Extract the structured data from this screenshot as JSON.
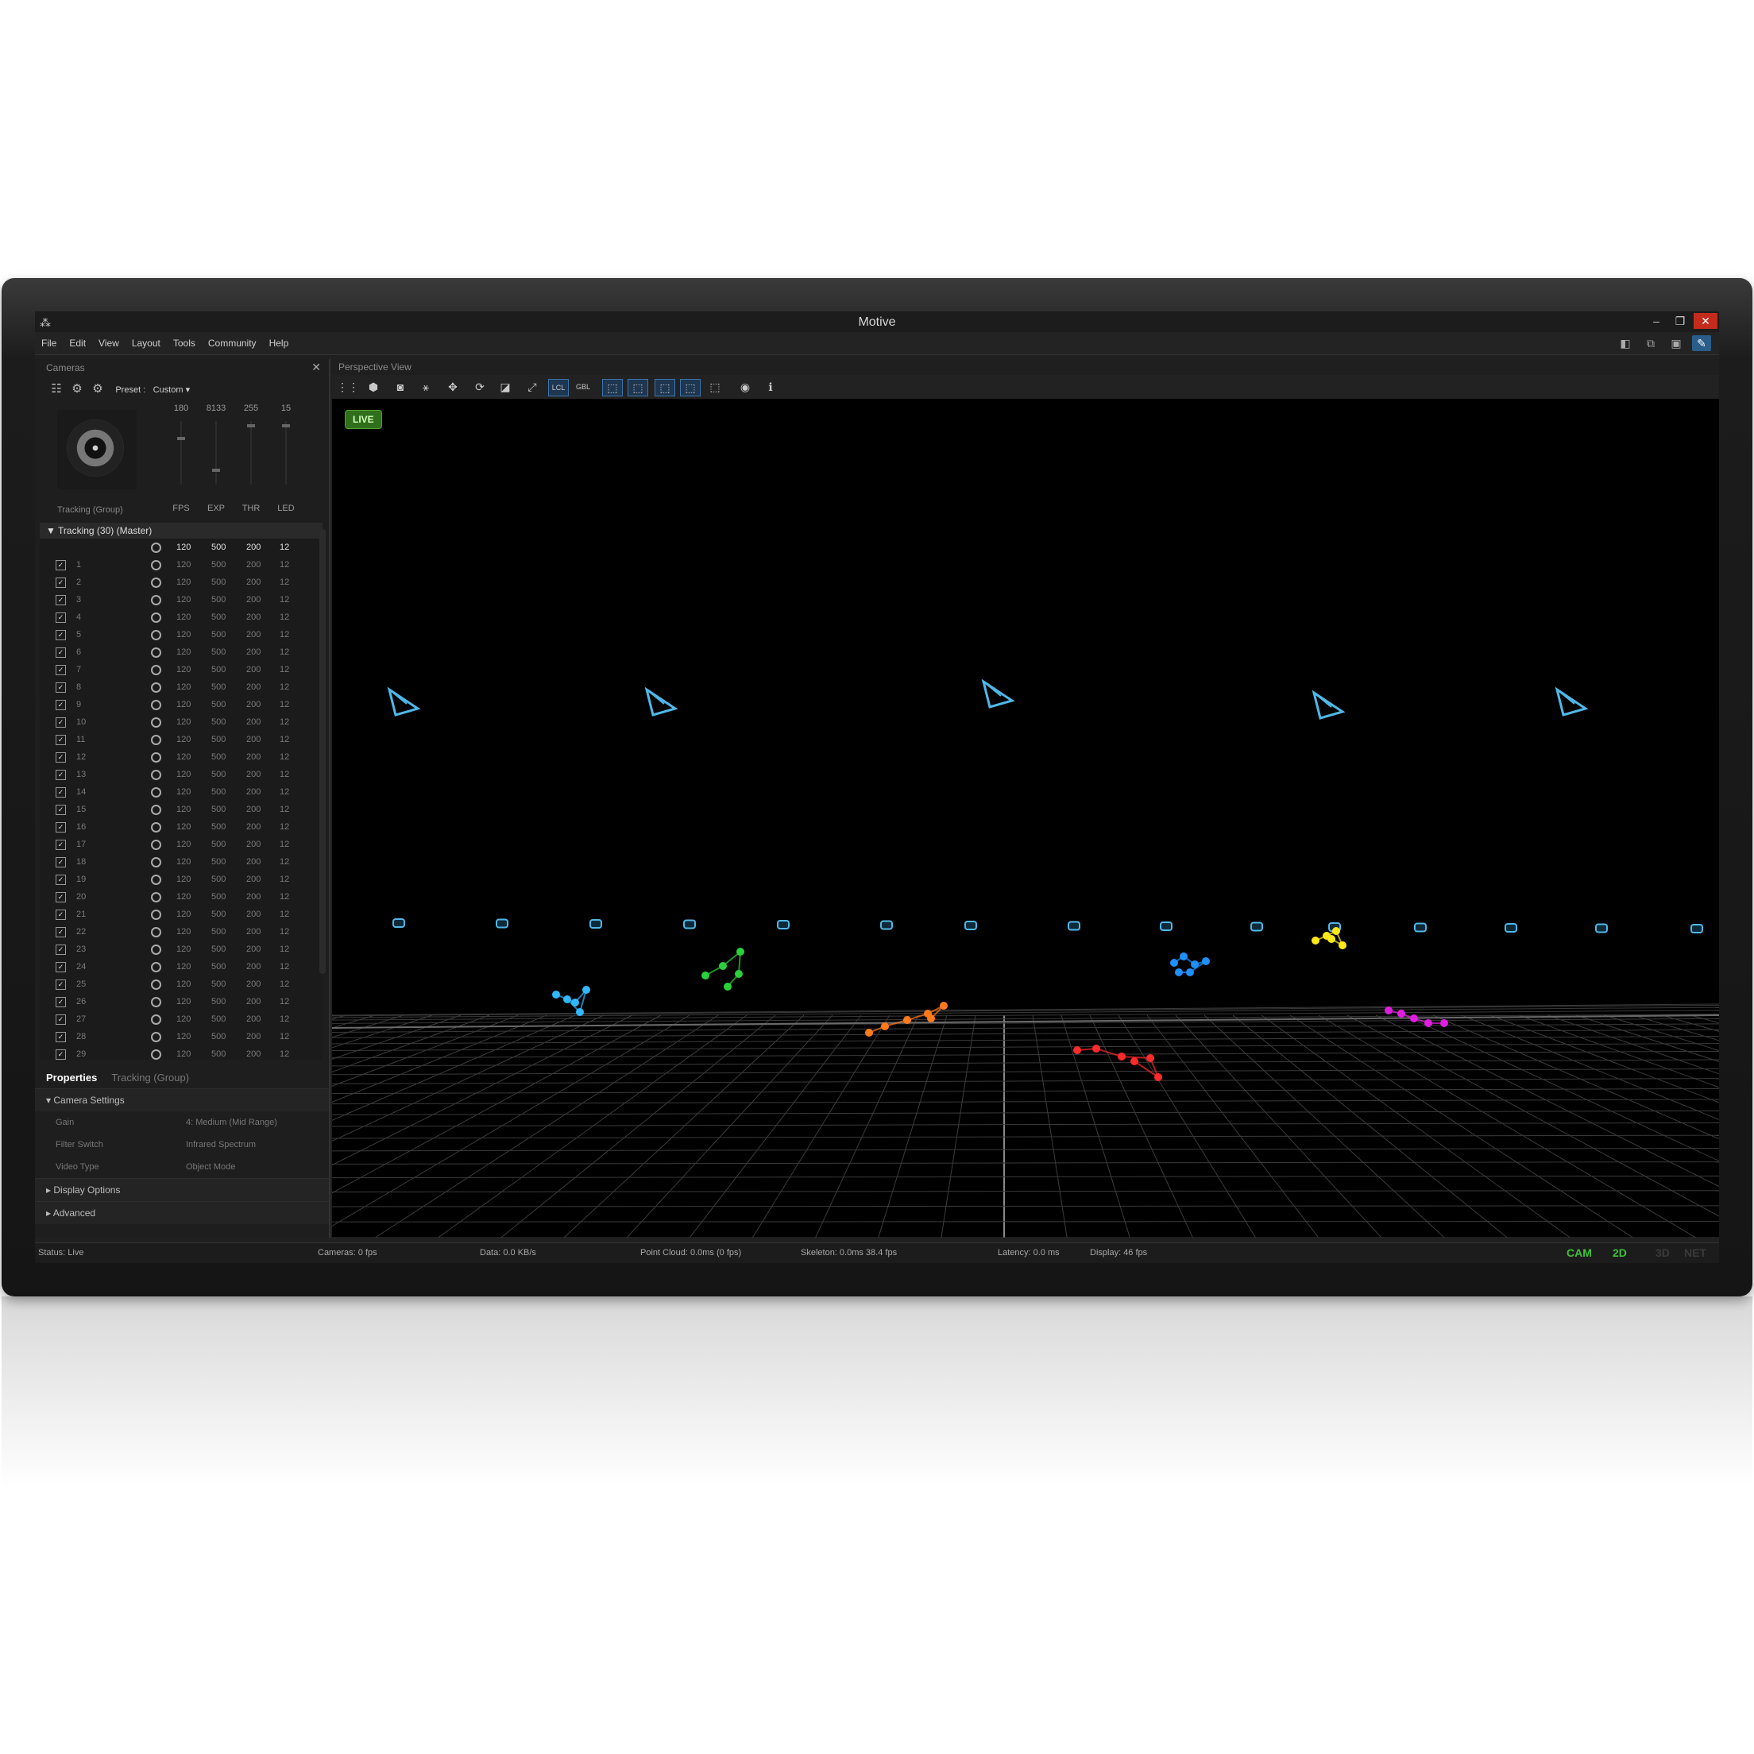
{
  "window": {
    "title": "Motive",
    "minimize_icon": "minimize-icon",
    "restore_icon": "restore-icon",
    "close_icon": "close-icon"
  },
  "menu": [
    "File",
    "Edit",
    "View",
    "Layout",
    "Tools",
    "Community",
    "Help"
  ],
  "cameras_panel": {
    "title": "Cameras",
    "preset_label": "Preset :",
    "preset_value": "Custom",
    "sliders": [
      {
        "value": "180",
        "label": "FPS"
      },
      {
        "value": "8133",
        "label": "EXP"
      },
      {
        "value": "255",
        "label": "THR"
      },
      {
        "value": "15",
        "label": "LED"
      }
    ],
    "preview_label": "Tracking (Group)",
    "group": {
      "label": "Tracking (30) (Master)",
      "fps": "120",
      "exp": "500",
      "thr": "200",
      "led": "12"
    },
    "rows": [
      {
        "id": "1",
        "fps": "120",
        "exp": "500",
        "thr": "200",
        "led": "12"
      },
      {
        "id": "2",
        "fps": "120",
        "exp": "500",
        "thr": "200",
        "led": "12"
      },
      {
        "id": "3",
        "fps": "120",
        "exp": "500",
        "thr": "200",
        "led": "12"
      },
      {
        "id": "4",
        "fps": "120",
        "exp": "500",
        "thr": "200",
        "led": "12"
      },
      {
        "id": "5",
        "fps": "120",
        "exp": "500",
        "thr": "200",
        "led": "12"
      },
      {
        "id": "6",
        "fps": "120",
        "exp": "500",
        "thr": "200",
        "led": "12"
      },
      {
        "id": "7",
        "fps": "120",
        "exp": "500",
        "thr": "200",
        "led": "12"
      },
      {
        "id": "8",
        "fps": "120",
        "exp": "500",
        "thr": "200",
        "led": "12"
      },
      {
        "id": "9",
        "fps": "120",
        "exp": "500",
        "thr": "200",
        "led": "12"
      },
      {
        "id": "10",
        "fps": "120",
        "exp": "500",
        "thr": "200",
        "led": "12"
      },
      {
        "id": "11",
        "fps": "120",
        "exp": "500",
        "thr": "200",
        "led": "12"
      },
      {
        "id": "12",
        "fps": "120",
        "exp": "500",
        "thr": "200",
        "led": "12"
      },
      {
        "id": "13",
        "fps": "120",
        "exp": "500",
        "thr": "200",
        "led": "12"
      },
      {
        "id": "14",
        "fps": "120",
        "exp": "500",
        "thr": "200",
        "led": "12"
      },
      {
        "id": "15",
        "fps": "120",
        "exp": "500",
        "thr": "200",
        "led": "12"
      },
      {
        "id": "16",
        "fps": "120",
        "exp": "500",
        "thr": "200",
        "led": "12"
      },
      {
        "id": "17",
        "fps": "120",
        "exp": "500",
        "thr": "200",
        "led": "12"
      },
      {
        "id": "18",
        "fps": "120",
        "exp": "500",
        "thr": "200",
        "led": "12"
      },
      {
        "id": "19",
        "fps": "120",
        "exp": "500",
        "thr": "200",
        "led": "12"
      },
      {
        "id": "20",
        "fps": "120",
        "exp": "500",
        "thr": "200",
        "led": "12"
      },
      {
        "id": "21",
        "fps": "120",
        "exp": "500",
        "thr": "200",
        "led": "12"
      },
      {
        "id": "22",
        "fps": "120",
        "exp": "500",
        "thr": "200",
        "led": "12"
      },
      {
        "id": "23",
        "fps": "120",
        "exp": "500",
        "thr": "200",
        "led": "12"
      },
      {
        "id": "24",
        "fps": "120",
        "exp": "500",
        "thr": "200",
        "led": "12"
      },
      {
        "id": "25",
        "fps": "120",
        "exp": "500",
        "thr": "200",
        "led": "12"
      },
      {
        "id": "26",
        "fps": "120",
        "exp": "500",
        "thr": "200",
        "led": "12"
      },
      {
        "id": "27",
        "fps": "120",
        "exp": "500",
        "thr": "200",
        "led": "12"
      },
      {
        "id": "28",
        "fps": "120",
        "exp": "500",
        "thr": "200",
        "led": "12"
      },
      {
        "id": "29",
        "fps": "120",
        "exp": "500",
        "thr": "200",
        "led": "12"
      }
    ]
  },
  "properties": {
    "tab_active": "Properties",
    "tab_secondary": "Tracking (Group)",
    "camera_settings": "Camera Settings",
    "fields": [
      {
        "name": "Gain",
        "value": "4: Medium (Mid Range)"
      },
      {
        "name": "Filter Switch",
        "value": "Infrared Spectrum"
      },
      {
        "name": "Video Type",
        "value": "Object Mode"
      }
    ],
    "display_options": "Display Options",
    "advanced": "Advanced"
  },
  "perspective": {
    "title": "Perspective View",
    "live": "LIVE",
    "toolbar_text_lcl": "LCL",
    "toolbar_text_gbl": "GBL",
    "rigid_body_colors": [
      "#2fb8ff",
      "#2bd13a",
      "#ff7a1a",
      "#ff2a2a",
      "#ffe81a",
      "#e01ee0",
      "#1e90ff"
    ],
    "camera_color": "#4fb8e8"
  },
  "status": {
    "status": "Status: Live",
    "cameras": "Cameras: 0 fps",
    "data": "Data: 0.0 KB/s",
    "point_cloud": "Point Cloud: 0.0ms (0 fps)",
    "skeleton": "Skeleton: 0.0ms 38.4 fps",
    "latency": "Latency: 0.0 ms",
    "display": "Display: 46 fps",
    "modes": [
      "CAM",
      "2D",
      "3D",
      "NET"
    ],
    "active_modes": [
      "CAM",
      "2D"
    ],
    "active_color": "#3ec23a",
    "inactive_color": "#3a3a3a"
  }
}
